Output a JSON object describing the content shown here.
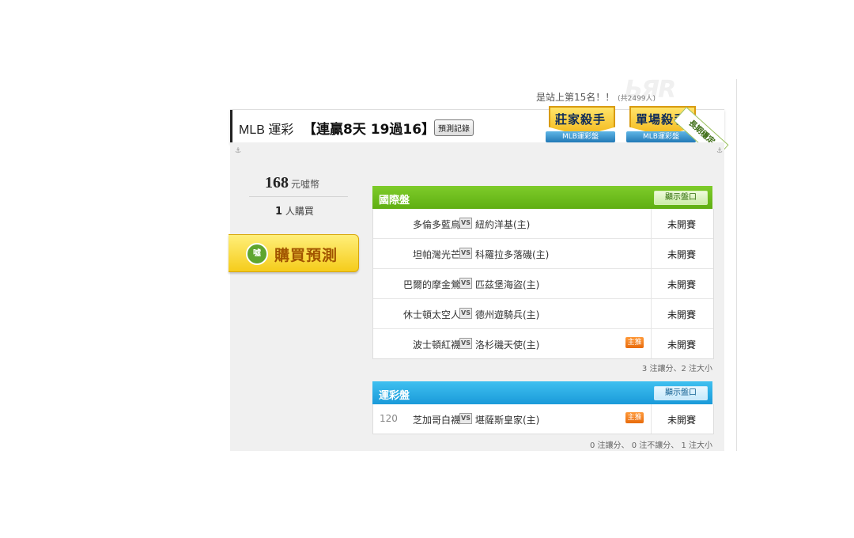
{
  "rank": {
    "text": "是站上第15名！！",
    "total": "(共2499人)"
  },
  "header": {
    "title": "MLB 運彩",
    "record": "【連贏8天 19過16】",
    "record_button": "預測記錄"
  },
  "badges": [
    {
      "name": "莊家殺手",
      "ribbon": "MLB運彩盤"
    },
    {
      "name": "單場殺手",
      "ribbon": "MLB運彩盤"
    }
  ],
  "longterm_ribbon": "長期穩定",
  "price": {
    "amount": "168",
    "unit": "元噓幣"
  },
  "buyers": {
    "count": "1",
    "label": "人購買"
  },
  "buy_button": {
    "coin_text": "噓",
    "label": "購買預測"
  },
  "sections": {
    "international": {
      "name": "國際盤",
      "show_button": "顯示盤口",
      "games": [
        {
          "away": "多倫多藍鳥",
          "vs": "VS",
          "home": "紐約洋基(主)",
          "tag": "",
          "status": "未開賽"
        },
        {
          "away": "坦帕灣光芒",
          "vs": "VS",
          "home": "科羅拉多落磯(主)",
          "tag": "",
          "status": "未開賽"
        },
        {
          "away": "巴爾的摩金鶯",
          "vs": "VS",
          "home": "匹茲堡海盜(主)",
          "tag": "",
          "status": "未開賽"
        },
        {
          "away": "休士頓太空人",
          "vs": "VS",
          "home": "德州遊騎兵(主)",
          "tag": "",
          "status": "未開賽"
        },
        {
          "away": "波士頓紅襪",
          "vs": "VS",
          "home": "洛杉磯天使(主)",
          "tag": "主推",
          "status": "未開賽"
        }
      ],
      "summary": "3 注讓分、2 注大小"
    },
    "lottery": {
      "name": "運彩盤",
      "show_button": "顯示盤口",
      "games": [
        {
          "num": "120",
          "away": "芝加哥白襪",
          "vs": "VS",
          "home": "堪薩斯皇家(主)",
          "tag": "主推",
          "status": "未開賽"
        }
      ],
      "summary": "0 注讓分、 0 注不讓分、 1 注大小"
    }
  },
  "colors": {
    "green_header": "#6bbd1d",
    "blue_header": "#25a6e0",
    "tag": "#f07a1a",
    "buy_button": "#f7d63a"
  }
}
